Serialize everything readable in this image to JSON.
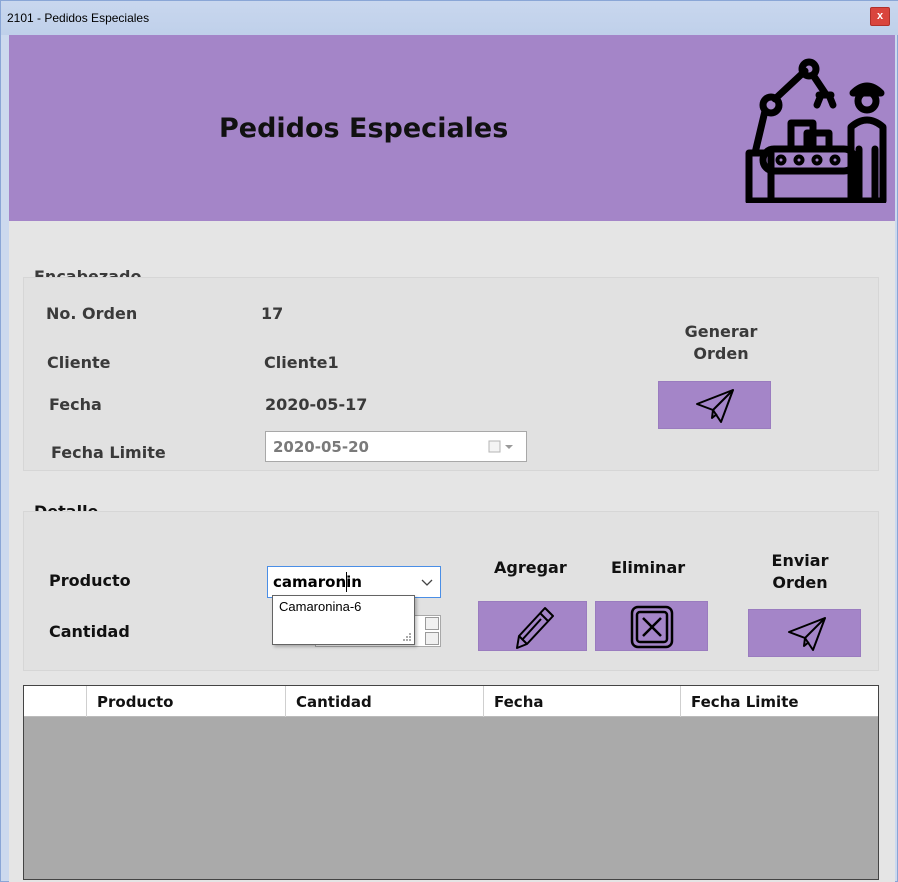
{
  "window": {
    "title": "2101 - Pedidos Especiales",
    "close_label": "x"
  },
  "header": {
    "title": "Pedidos Especiales",
    "icon": "factory-icon"
  },
  "encabezado": {
    "group_label": "Encabezado",
    "orden_label": "No. Orden",
    "orden_value": "17",
    "cliente_label": "Cliente",
    "cliente_value": "Cliente1",
    "fecha_label": "Fecha",
    "fecha_value": "2020-05-17",
    "fecha_limite_label": "Fecha Limite",
    "fecha_limite_value": "2020-05-20",
    "generar_label_line1": "Generar",
    "generar_label_line2": "Orden",
    "generar_icon": "paper-plane-icon"
  },
  "detalle": {
    "group_label": "Detalle",
    "producto_label": "Producto",
    "producto_value": "camaronin",
    "producto_suggestion": "Camaronina-6",
    "cantidad_label": "Cantidad",
    "agregar_label": "Agregar",
    "agregar_icon": "pencil-icon",
    "eliminar_label": "Eliminar",
    "eliminar_icon": "close-box-icon",
    "enviar_label_line1": "Enviar",
    "enviar_label_line2": "Orden",
    "enviar_icon": "paper-plane-icon"
  },
  "table": {
    "columns": [
      "",
      "Producto",
      "Cantidad",
      "Fecha",
      "Fecha Limite"
    ],
    "rows": []
  },
  "colors": {
    "accent": "#a485c8",
    "client_bg": "#e5e5e5",
    "grid_bg": "#aaaaaa"
  }
}
